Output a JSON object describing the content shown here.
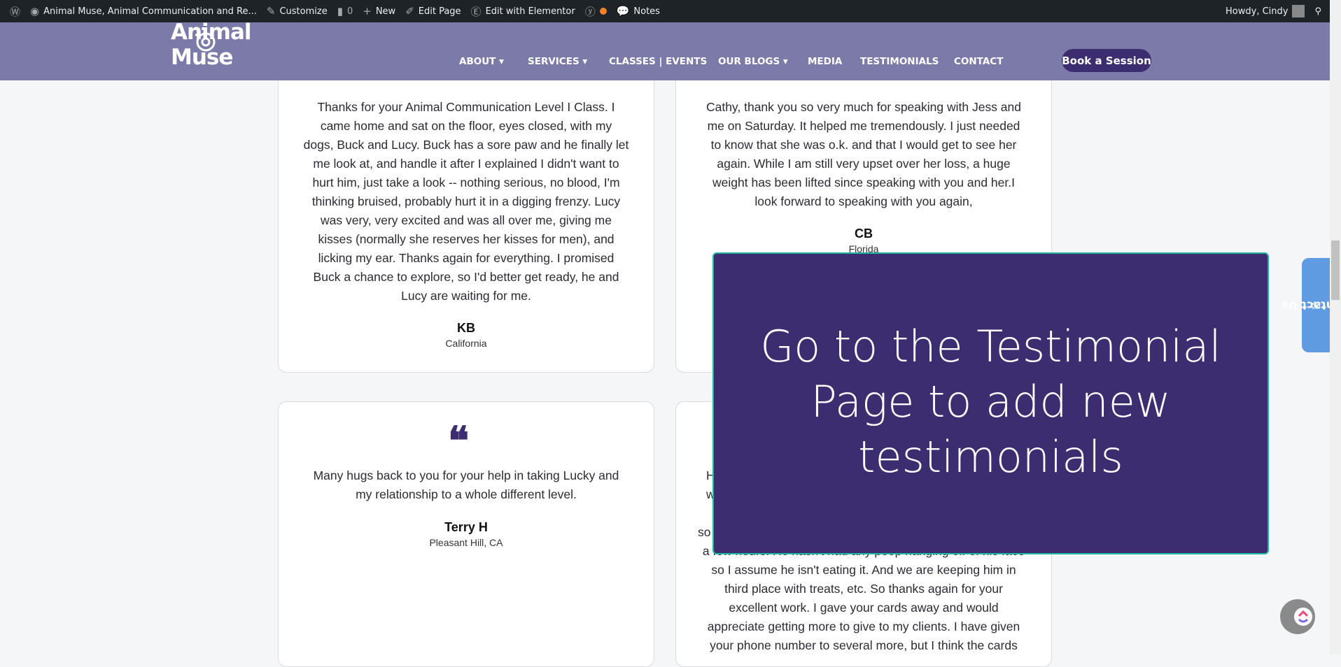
{
  "adminbar": {
    "site": "Animal Muse, Animal Communication and Re...",
    "customize": "Customize",
    "comments": "0",
    "new": "New",
    "edit_page": "Edit Page",
    "elementor": "Edit with Elementor",
    "notes": "Notes",
    "howdy": "Howdy, Cindy"
  },
  "header": {
    "logo": "Animal Muse",
    "nav": [
      "ABOUT",
      "SERVICES",
      "CLASSES | EVENTS",
      "OUR BLOGS",
      "MEDIA",
      "TESTIMONIALS",
      "CONTACT"
    ],
    "book": "Book a Session"
  },
  "testimonials": [
    {
      "lines": [
        "Thanks for your Animal Communication Level I Class. I",
        "came home and sat on the floor, eyes closed, with my",
        "dogs, Buck and Lucy. Buck has a sore paw and he finally let",
        "me look at, and handle it after I explained I didn't want to",
        "hurt him, just take a look -- nothing serious, no blood, I'm",
        "thinking bruised, probably hurt it in a digging frenzy. Lucy",
        "was very, very excited and was all over me, giving me",
        "kisses (normally she reserves her kisses for men), and",
        "licking my ear. Thanks again for everything. I promised",
        "Buck a chance to explore, so I'd better get ready, he and",
        "Lucy are waiting for me."
      ],
      "name": "KB",
      "location": "California"
    },
    {
      "lines": [
        "Cathy, thank you so very much for speaking with Jess and",
        "me on Saturday. It helped me tremendously. I just needed",
        "to know that she was o.k. and that I would get to see her",
        "again. While I am still very upset over her loss, a huge",
        "weight has been lifted since speaking with you and her.I",
        "look forward to speaking with you again,"
      ],
      "name": "CB",
      "location": "Florida"
    },
    {
      "lines": [
        "Many hugs back to you for your help in taking Lucky and",
        "my relationship to a whole different level."
      ],
      "name": "Terry H",
      "location": "Pleasant Hill, CA"
    },
    {
      "lines": [
        "H",
        "w",
        "",
        "so",
        "a few hours. He hasn't had any poop hanging off of his face",
        "so I assume he isn't eating it. And we are keeping him in",
        "third place with treats, etc. So thanks again for your",
        "excellent work. I gave your cards away and would",
        "appreciate getting more to give to my clients. I have given",
        "your phone number to several more, but I think the cards"
      ]
    }
  ],
  "overlay": {
    "lines": [
      "Go to the Testimonial",
      "Page to add new",
      "testimonials"
    ]
  },
  "contact_tab": "Contact Us",
  "colors": {
    "header": "#7b7aa8",
    "brand": "#3b2d70",
    "accent": "#1fb5a0",
    "contact": "#5e9be0"
  }
}
